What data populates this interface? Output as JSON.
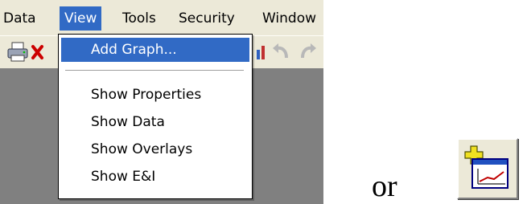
{
  "menubar": {
    "items": [
      {
        "label": "Data"
      },
      {
        "label": "View"
      },
      {
        "label": "Tools"
      },
      {
        "label": "Security"
      },
      {
        "label": "Window"
      }
    ],
    "active_index": 1
  },
  "toolbar": {
    "icons": [
      "printer-icon",
      "delete-x-icon",
      "chart-icon",
      "undo-arrow-icon",
      "redo-arrow-icon"
    ]
  },
  "view_menu": {
    "items": [
      {
        "label": "Add Graph...",
        "highlighted": true
      },
      {
        "separator": true
      },
      {
        "label": "Show Properties"
      },
      {
        "label": "Show Data"
      },
      {
        "label": "Show Overlays"
      },
      {
        "label": "Show E&I"
      }
    ]
  },
  "or_text": "or",
  "add_graph_button": {
    "icon": "add-graph-icon"
  },
  "colors": {
    "menu_bg": "#ece9d8",
    "highlight": "#316ac5",
    "client_area": "#808080"
  }
}
